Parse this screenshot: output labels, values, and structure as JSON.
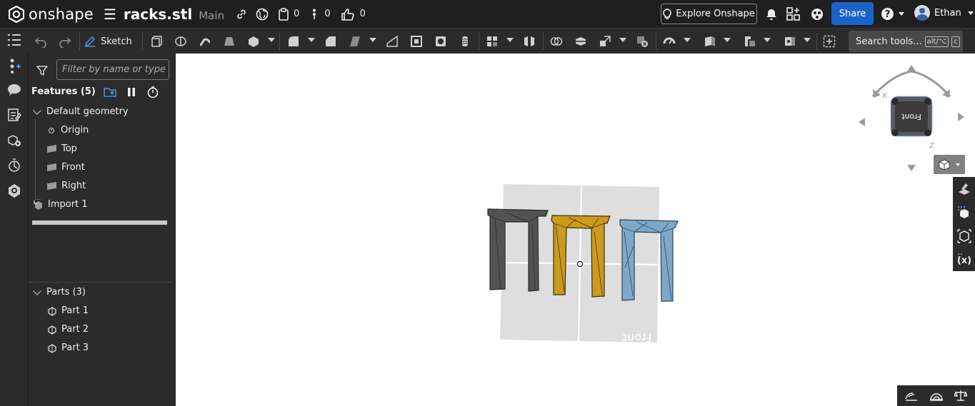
{
  "app": {
    "brand": "onshape",
    "document_name": "racks.stl",
    "branch": "Main"
  },
  "header": {
    "versions_count": "0",
    "comments_count": "0",
    "likes_count": "0",
    "explore_label": "Explore Onshape",
    "share_label": "Share",
    "user_name": "Ethan"
  },
  "toolbar": {
    "sketch_label": "Sketch",
    "search_label": "Search tools...",
    "search_shortcut_1": "alt/⌥",
    "search_shortcut_2": "c"
  },
  "feature_panel": {
    "filter_placeholder": "Filter by name or type",
    "features_title": "Features (5)",
    "default_geometry_label": "Default geometry",
    "items": [
      {
        "label": "Origin",
        "icon": "origin-icon"
      },
      {
        "label": "Top",
        "icon": "plane-icon"
      },
      {
        "label": "Front",
        "icon": "plane-icon"
      },
      {
        "label": "Right",
        "icon": "plane-icon"
      }
    ],
    "import_label": "Import 1",
    "parts_title": "Parts (3)",
    "parts": [
      {
        "label": "Part 1"
      },
      {
        "label": "Part 2"
      },
      {
        "label": "Part 3"
      }
    ]
  },
  "viewport": {
    "plane_label": "Front",
    "viewcube_face": "Front",
    "axis_x": "X",
    "axis_z": "Z",
    "part_colors": [
      "#4a4a4a",
      "#c89a1c",
      "#7ea8c8"
    ]
  },
  "colors": {
    "accent": "#1b63c9",
    "bg_dark": "#2b2b2b",
    "topbar": "#1f1f1f"
  }
}
